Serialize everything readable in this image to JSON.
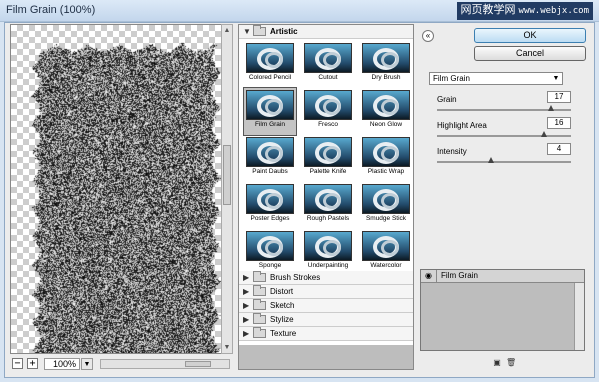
{
  "window": {
    "title": "Film Grain (100%)"
  },
  "watermark": {
    "text": "网页教学网",
    "url": "www.webjx.com"
  },
  "preview": {
    "zoom": "100%",
    "zoom_out_label": "−",
    "zoom_in_label": "+"
  },
  "gallery": {
    "open_category": "Artistic",
    "filters": [
      {
        "label": "Colored Pencil",
        "selected": false
      },
      {
        "label": "Cutout",
        "selected": false
      },
      {
        "label": "Dry Brush",
        "selected": false
      },
      {
        "label": "Film Grain",
        "selected": true
      },
      {
        "label": "Fresco",
        "selected": false
      },
      {
        "label": "Neon Glow",
        "selected": false
      },
      {
        "label": "Paint Daubs",
        "selected": false
      },
      {
        "label": "Palette Knife",
        "selected": false
      },
      {
        "label": "Plastic Wrap",
        "selected": false
      },
      {
        "label": "Poster Edges",
        "selected": false
      },
      {
        "label": "Rough Pastels",
        "selected": false
      },
      {
        "label": "Smudge Stick",
        "selected": false
      },
      {
        "label": "Sponge",
        "selected": false
      },
      {
        "label": "Underpainting",
        "selected": false
      },
      {
        "label": "Watercolor",
        "selected": false
      }
    ],
    "categories": [
      "Brush Strokes",
      "Distort",
      "Sketch",
      "Stylize",
      "Texture"
    ]
  },
  "buttons": {
    "ok": "OK",
    "cancel": "Cancel"
  },
  "settings": {
    "filter_select": "Film Grain",
    "params": [
      {
        "label": "Grain",
        "value": "17",
        "fraction": 0.85
      },
      {
        "label": "Highlight Area",
        "value": "16",
        "fraction": 0.8
      },
      {
        "label": "Intensity",
        "value": "4",
        "fraction": 0.4
      }
    ]
  },
  "effect_layers": [
    {
      "name": "Film Grain"
    }
  ]
}
